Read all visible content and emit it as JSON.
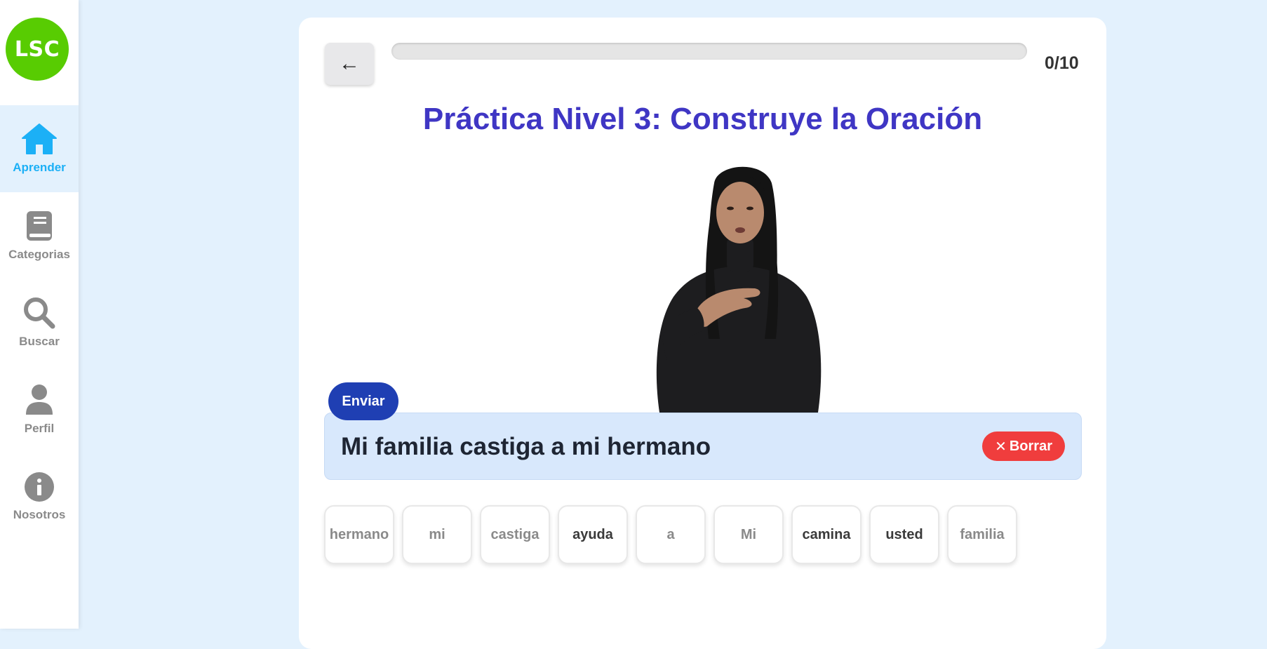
{
  "sidebar": {
    "logo_text": "LSC",
    "items": [
      {
        "label": "Aprender",
        "icon": "home-icon",
        "active": true
      },
      {
        "label": "Categorias",
        "icon": "book-icon",
        "active": false
      },
      {
        "label": "Buscar",
        "icon": "search-icon",
        "active": false
      },
      {
        "label": "Perfil",
        "icon": "user-icon",
        "active": false
      },
      {
        "label": "Nosotros",
        "icon": "info-icon",
        "active": false
      }
    ]
  },
  "header": {
    "back_label": "←",
    "progress": {
      "current": 0,
      "total": 10,
      "fraction": 0
    },
    "counter": "0/10"
  },
  "title": "Práctica Nivel 3: Construye la Oración",
  "submit_label": "Enviar",
  "answer": {
    "text": "Mi familia castiga a mi hermano",
    "clear_icon": "✕",
    "clear_label": "Borrar"
  },
  "word_bank": [
    {
      "label": "hermano",
      "used": true
    },
    {
      "label": "mi",
      "used": true
    },
    {
      "label": "castiga",
      "used": true
    },
    {
      "label": "ayuda",
      "used": false
    },
    {
      "label": "a",
      "used": true
    },
    {
      "label": "Mi",
      "used": true
    },
    {
      "label": "camina",
      "used": false
    },
    {
      "label": "usted",
      "used": false
    },
    {
      "label": "familia",
      "used": true
    }
  ],
  "colors": {
    "accent_green": "#58cc02",
    "active_blue": "#1cb0f6",
    "title_purple": "#3f36c4",
    "submit_blue": "#1f3fb3",
    "clear_red": "#f03d3d",
    "background": "#e3f1fd"
  }
}
